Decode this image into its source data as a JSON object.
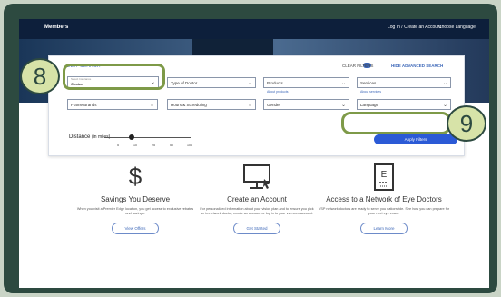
{
  "topbar": {
    "members": "Members",
    "login": "Log In / Create an Account",
    "language": "Choose Language"
  },
  "search": {
    "edit_search": "EDIT SEARCH",
    "clear_filters": "CLEAR FILTERS",
    "advanced": "HIDE ADVANCED SEARCH",
    "selects": [
      {
        "small": "Select Insurance",
        "label": "Choice"
      },
      {
        "label": "Type of Doctor"
      },
      {
        "label": "Products",
        "about": "About products"
      },
      {
        "label": "Services",
        "about": "About services"
      },
      {
        "label": "Frame Brands"
      },
      {
        "label": "Hours & Scheduling"
      },
      {
        "label": "Gender"
      },
      {
        "label": "Language"
      }
    ],
    "distance_label": "Distance",
    "distance_unit": "(in miles)",
    "distance_ticks": [
      "5",
      "10",
      "25",
      "50",
      "100"
    ],
    "distance_selected": "10",
    "apply": "Apply Filters"
  },
  "features": [
    {
      "icon": "dollar-icon",
      "title": "Savings You Deserve",
      "desc": "When you visit a Premier Edge location, you get access to exclusive rebates and savings.",
      "button": "View Offers"
    },
    {
      "icon": "computer-icon",
      "title": "Create an Account",
      "desc": "For personalized information about your vision plan and to ensure you pick an in-network doctor, create an account or log in to your vsp.com account.",
      "button": "Get Started"
    },
    {
      "icon": "eye-chart-icon",
      "title": "Access to a Network of Eye Doctors",
      "desc": "VSP network doctors are ready to serve you nationwide. See how you can prepare for your next eye exam.",
      "button": "Learn More"
    }
  ],
  "callouts": {
    "first": "8",
    "second": "9"
  },
  "colors": {
    "frame": "#2d4a40",
    "callout_border": "#7e9a48",
    "callout_fill": "#d7e3a8",
    "apply": "#2b5ad6",
    "link": "#3c67b8"
  }
}
